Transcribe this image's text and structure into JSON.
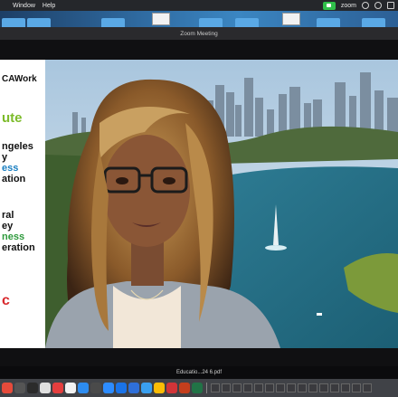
{
  "menubar": {
    "items": [
      "Window",
      "Help"
    ],
    "zoom_label": "zoom"
  },
  "window": {
    "title": "Zoom Meeting"
  },
  "banner": {
    "lines": [
      {
        "text": "CAWork",
        "color": "#111111"
      },
      {
        "text": "ute",
        "color": "#7cbb2a"
      },
      {
        "text": "ngeles",
        "color": "#111111"
      },
      {
        "text": "y",
        "color": "#111111"
      },
      {
        "text": "ess",
        "color": "#1a7fc1"
      },
      {
        "text": "ation",
        "color": "#111111"
      },
      {
        "text": "ral",
        "color": "#111111"
      },
      {
        "text": "ey",
        "color": "#111111"
      },
      {
        "text": "ness",
        "color": "#2e9a3c"
      },
      {
        "text": "eration",
        "color": "#111111"
      },
      {
        "text": "c",
        "color": "#d8282c"
      }
    ]
  },
  "taskbar": {
    "file_label": "Educatio...24 6.pdf"
  },
  "colors": {
    "camera_on": "#2fbf4a",
    "window_bg": "#101012",
    "titlebar_bg": "#2a2a2d"
  },
  "icons": [
    "camera-icon",
    "zoom-menu-icon",
    "wifi-icon",
    "bluetooth-icon",
    "control-center-icon",
    "folder-icon",
    "document-icon"
  ]
}
